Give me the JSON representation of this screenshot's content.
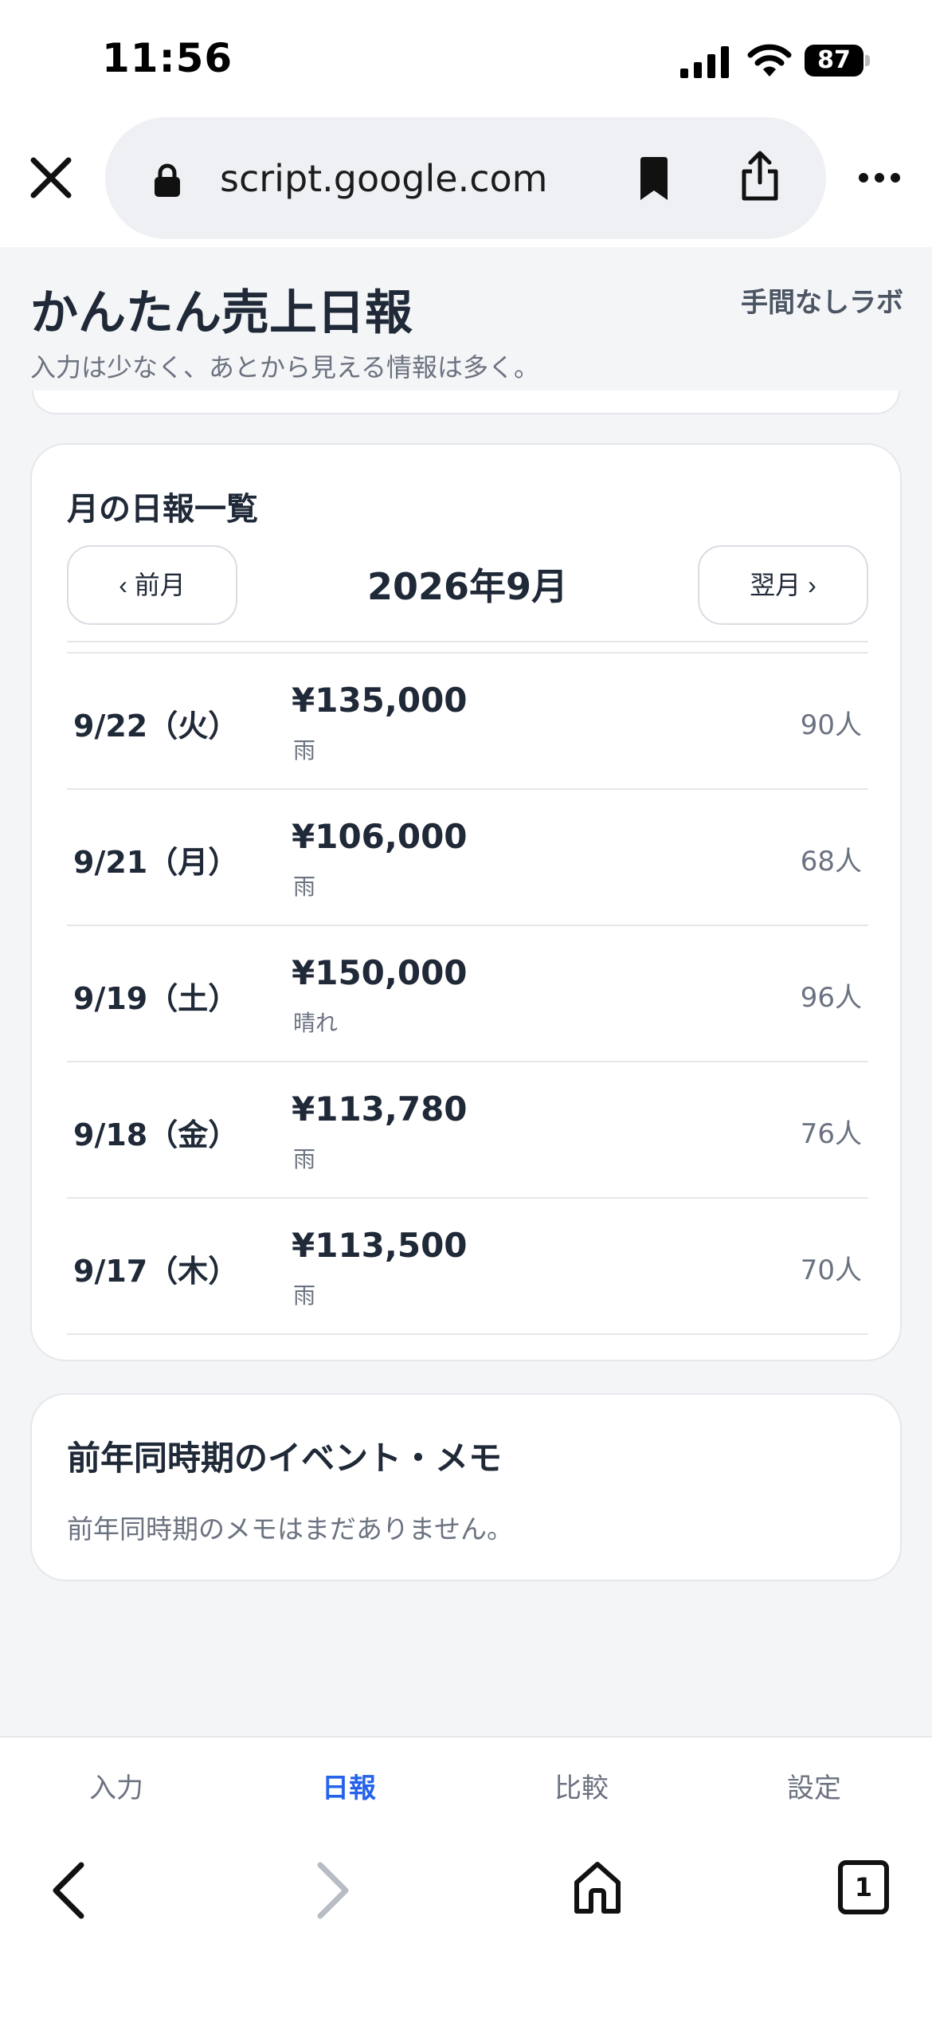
{
  "status_bar": {
    "time": "11:56",
    "battery": "87"
  },
  "browser": {
    "url": "script.google.com"
  },
  "header": {
    "title": "かんたん売上日報",
    "subtitle": "入力は少なく、あとから見える情報は多く。",
    "brand": "手間なしラボ"
  },
  "report_card": {
    "title": "月の日報一覧",
    "prev_label": "‹ 前月",
    "next_label": "翌月 ›",
    "month": "2026年9月",
    "rows": [
      {
        "date": "9/22（火）",
        "amount": "¥135,000",
        "weather": "雨",
        "count": "90人"
      },
      {
        "date": "9/21（月）",
        "amount": "¥106,000",
        "weather": "雨",
        "count": "68人"
      },
      {
        "date": "9/19（土）",
        "amount": "¥150,000",
        "weather": "晴れ",
        "count": "96人"
      },
      {
        "date": "9/18（金）",
        "amount": "¥113,780",
        "weather": "雨",
        "count": "76人"
      },
      {
        "date": "9/17（木）",
        "amount": "¥113,500",
        "weather": "雨",
        "count": "70人"
      }
    ]
  },
  "memo_card": {
    "title": "前年同時期のイベント・メモ",
    "text": "前年同時期のメモはまだありません。"
  },
  "nav": {
    "tabs": [
      {
        "label": "入力",
        "active": false
      },
      {
        "label": "日報",
        "active": true
      },
      {
        "label": "比較",
        "active": false
      },
      {
        "label": "設定",
        "active": false
      }
    ]
  },
  "toolbar": {
    "tab_count": "1"
  },
  "colors": {
    "accent": "#2563eb",
    "text": "#1f2937",
    "muted": "#6b7280",
    "background": "#f4f5f7"
  }
}
